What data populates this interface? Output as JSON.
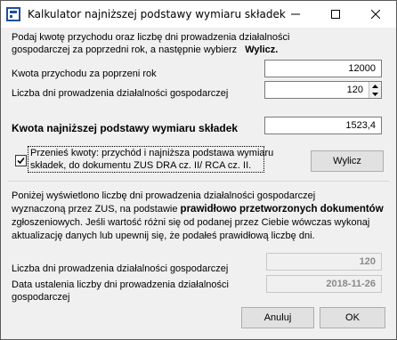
{
  "window": {
    "title": "Kalkulator najniższej podstawy wymiaru składek"
  },
  "intro": {
    "line1": "Podaj kwotę przychodu oraz liczbę dni prowadzenia działalności",
    "line2": "gospodarczej za poprzedni rok, a następnie wybierz",
    "action_word": "Wylicz."
  },
  "income": {
    "label": "Kwota przychodu za poprzeni rok",
    "value": "12000"
  },
  "days": {
    "label": "Liczba dni prowadzenia działalności gospodarczej",
    "value": "120"
  },
  "base": {
    "label": "Kwota najniższej podstawy wymiaru składek",
    "value": "1523,4"
  },
  "transfer": {
    "checked": true,
    "line1": "Przenieś kwoty: przychód i najniższa podstawa wymiaru",
    "line2": "składek, do dokumentu ZUS DRA cz. II/ RCA cz. II."
  },
  "compute_button": {
    "label": "Wylicz"
  },
  "info": {
    "line1": "Poniżej wyświetlono liczbę dni prowadzenia działalności gospodarczej",
    "line2_a": "wyznaczoną przez ZUS, na podstawie",
    "line2_b": "prawidłowo przetworzonych dokumentów",
    "line3": "zgłoszeniowych. Jeśli wartość różni się od podanej przez Ciebie wówczas wykonaj",
    "line4": "aktualizację danych lub upewnij się, że podałeś prawidłową liczbę dni."
  },
  "zus_days": {
    "label": "Liczba dni prowadzenia działalności gospodarczej",
    "value": "120"
  },
  "zus_date": {
    "label_line1": "Data ustalenia liczby dni prowadzenia działalności",
    "label_line2": "gospodarczej",
    "value": "2018-11-26"
  },
  "footer": {
    "cancel_label": "Anuluj",
    "ok_label": "OK"
  }
}
